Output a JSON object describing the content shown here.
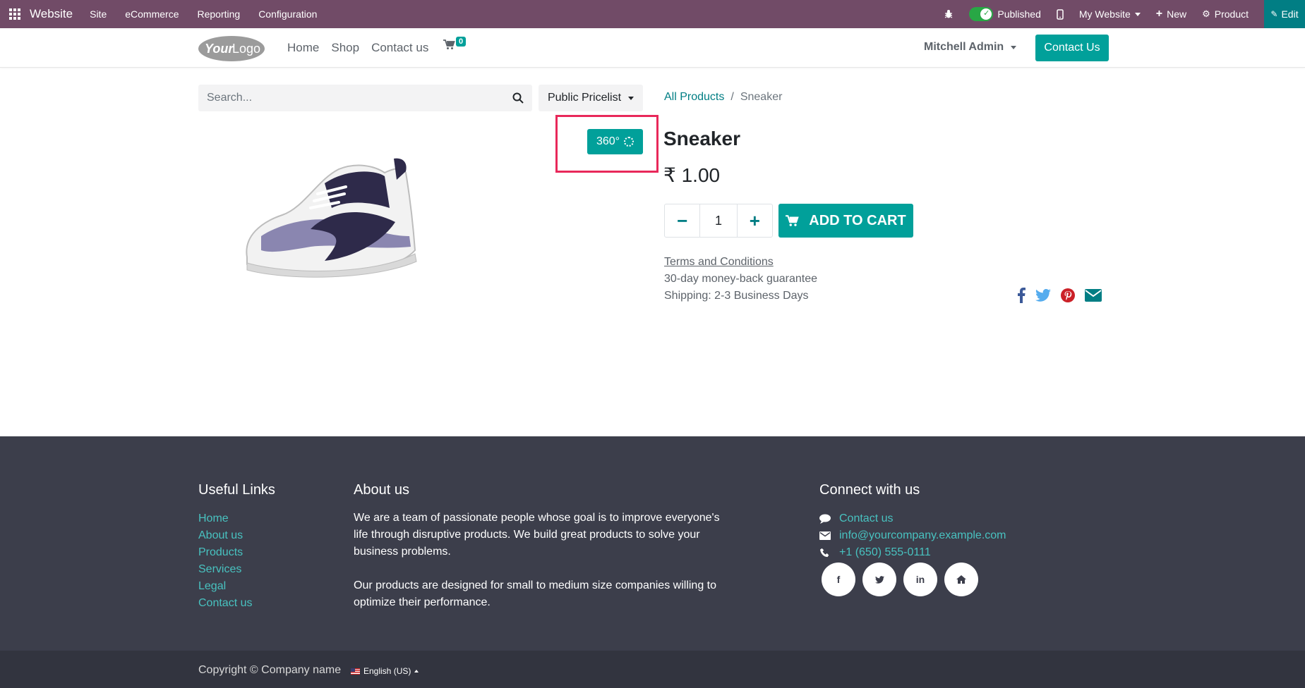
{
  "adminbar": {
    "brand": "Website",
    "menus": [
      "Site",
      "eCommerce",
      "Reporting",
      "Configuration"
    ],
    "published_label": "Published",
    "website_label": "My Website",
    "new_label": "New",
    "product_label": "Product",
    "edit_label": "Edit"
  },
  "header": {
    "logo_text": "YourLogo",
    "nav": [
      "Home",
      "Shop",
      "Contact us"
    ],
    "cart_count": "0",
    "user": "Mitchell Admin",
    "contact_button": "Contact Us"
  },
  "product": {
    "search_placeholder": "Search...",
    "pricelist": "Public Pricelist",
    "breadcrumb_parent": "All Products",
    "breadcrumb_sep": "/",
    "breadcrumb_current": "Sneaker",
    "view360_label": "360°",
    "name": "Sneaker",
    "price": "₹ 1.00",
    "quantity": "1",
    "add_to_cart": "ADD TO CART",
    "terms": "Terms and Conditions",
    "guarantee": "30-day money-back guarantee",
    "shipping": "Shipping: 2-3 Business Days"
  },
  "footer": {
    "useful_links_title": "Useful Links",
    "useful_links": [
      "Home",
      "About us",
      "Products",
      "Services",
      "Legal",
      "Contact us"
    ],
    "about_title": "About us",
    "about_p1": "We are a team of passionate people whose goal is to improve everyone's life through disruptive products. We build great products to solve your business problems.",
    "about_p2": "Our products are designed for small to medium size companies willing to optimize their performance.",
    "connect_title": "Connect with us",
    "connect_contact": "Contact us",
    "connect_email": "info@yourcompany.example.com",
    "connect_phone": "+1 (650) 555-0111",
    "social_icons": [
      "facebook-icon",
      "twitter-icon",
      "linkedin-icon",
      "home-icon"
    ],
    "copyright": "Copyright © Company name",
    "language": "English (US)"
  },
  "colors": {
    "admin_bar": "#714b67",
    "accent": "#01a09a",
    "highlight": "#e8285a",
    "footer": "#3c3e4b"
  }
}
